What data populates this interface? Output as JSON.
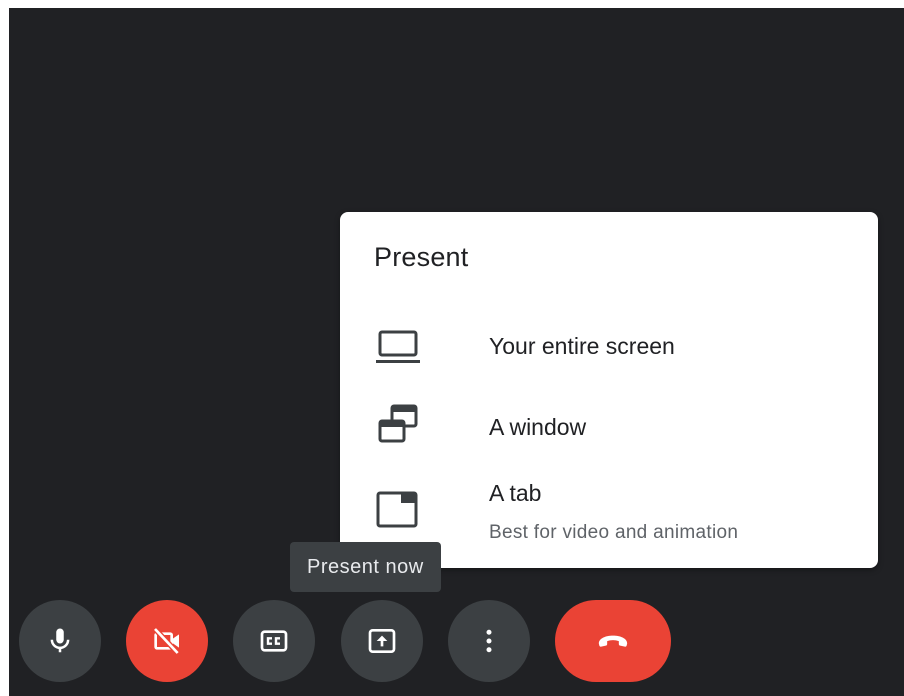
{
  "present_menu": {
    "title": "Present",
    "items": [
      {
        "label": "Your entire screen",
        "icon": "laptop-icon"
      },
      {
        "label": "A window",
        "icon": "window-stack-icon"
      },
      {
        "label": "A tab",
        "sublabel": "Best for video and animation",
        "icon": "browser-tab-icon"
      }
    ]
  },
  "tooltip": {
    "text": "Present now"
  },
  "controls": [
    {
      "name": "microphone",
      "icon": "microphone-icon"
    },
    {
      "name": "camera",
      "icon": "camera-off-icon",
      "state": "off",
      "color": "#ea4335"
    },
    {
      "name": "captions",
      "icon": "closed-captions-icon"
    },
    {
      "name": "present",
      "icon": "present-screen-icon"
    },
    {
      "name": "more-options",
      "icon": "more-vertical-icon"
    },
    {
      "name": "leave-call",
      "icon": "phone-hangup-icon",
      "color": "#ea4335"
    }
  ],
  "colors": {
    "background": "#202124",
    "button": "#3c4043",
    "danger": "#ea4335",
    "menu_bg": "#ffffff",
    "tooltip_bg": "#3c4043"
  }
}
